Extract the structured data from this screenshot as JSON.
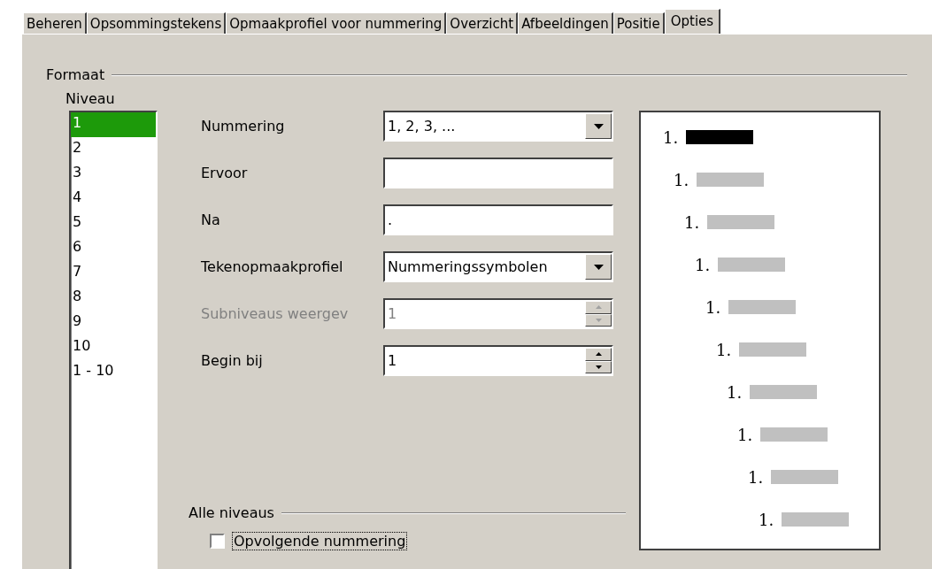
{
  "tabs": [
    {
      "label": "Beheren",
      "selected": false
    },
    {
      "label": "Opsommingstekens",
      "selected": false
    },
    {
      "label": "Opmaakprofiel voor nummering",
      "selected": false
    },
    {
      "label": "Overzicht",
      "selected": false
    },
    {
      "label": "Afbeeldingen",
      "selected": false
    },
    {
      "label": "Positie",
      "selected": false
    },
    {
      "label": "Opties",
      "selected": true
    }
  ],
  "format": {
    "title": "Formaat",
    "level_label": "Niveau",
    "levels": [
      {
        "label": "1",
        "selected": true
      },
      {
        "label": "2",
        "selected": false
      },
      {
        "label": "3",
        "selected": false
      },
      {
        "label": "4",
        "selected": false
      },
      {
        "label": "5",
        "selected": false
      },
      {
        "label": "6",
        "selected": false
      },
      {
        "label": "7",
        "selected": false
      },
      {
        "label": "8",
        "selected": false
      },
      {
        "label": "9",
        "selected": false
      },
      {
        "label": "10",
        "selected": false
      },
      {
        "label": "1 - 10",
        "selected": false
      }
    ],
    "fields": [
      {
        "kind": "dropdown",
        "label": "Nummering",
        "value": "1, 2, 3, ...",
        "disabled": false
      },
      {
        "kind": "text",
        "label": "Ervoor",
        "disabled": false
      },
      {
        "kind": "text",
        "label": "Na",
        "value": ".",
        "disabled": false
      },
      {
        "kind": "dropdown",
        "label": "Tekenopmaakprofiel",
        "value": "Nummeringssymbolen",
        "disabled": false
      },
      {
        "kind": "spin",
        "label": "Subniveaus weergev",
        "value": "1",
        "disabled": true
      },
      {
        "kind": "spin",
        "label": "Begin bij",
        "value": "1",
        "disabled": false
      }
    ]
  },
  "all_levels": {
    "title": "Alle niveaus",
    "checkbox": {
      "label": "Opvolgende nummering",
      "checked": false
    }
  },
  "preview": {
    "items": [
      {
        "number": "1.",
        "selected": true
      },
      {
        "number": "1.",
        "selected": false
      },
      {
        "number": "1.",
        "selected": false
      },
      {
        "number": "1.",
        "selected": false
      },
      {
        "number": "1.",
        "selected": false
      },
      {
        "number": "1.",
        "selected": false
      },
      {
        "number": "1.",
        "selected": false
      },
      {
        "number": "1.",
        "selected": false
      },
      {
        "number": "1.",
        "selected": false
      },
      {
        "number": "1.",
        "selected": false
      }
    ]
  }
}
